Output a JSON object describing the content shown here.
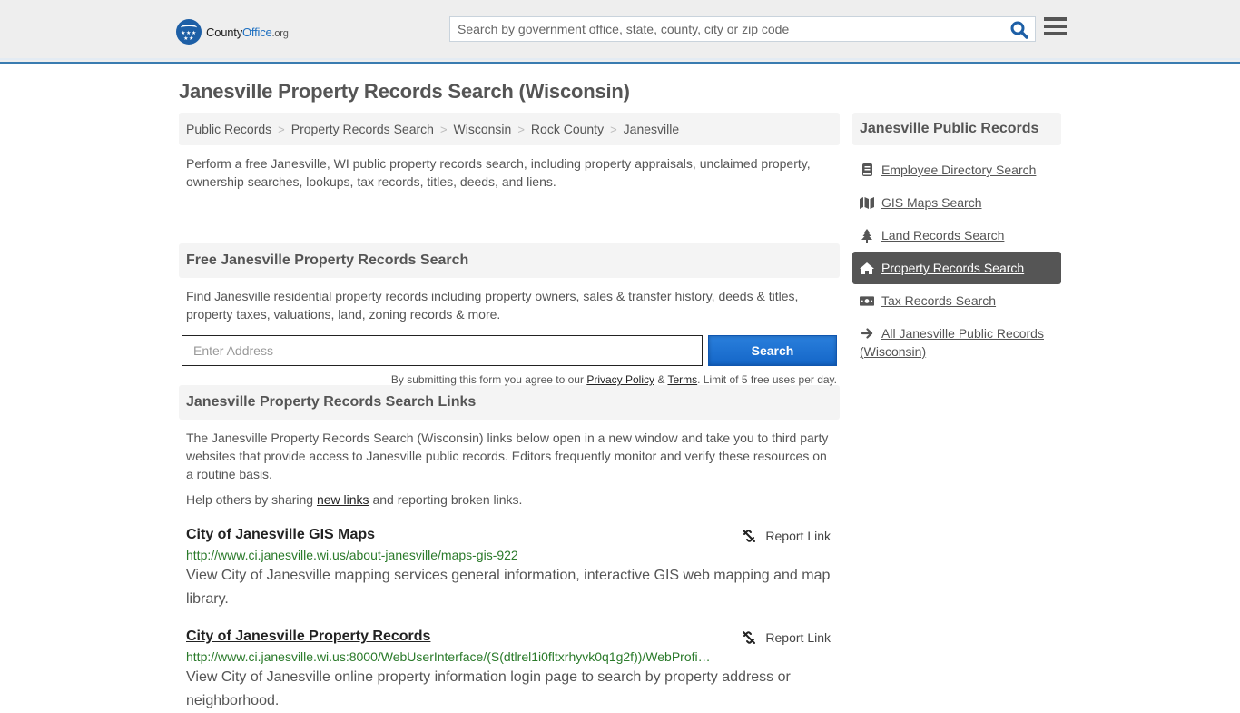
{
  "header": {
    "logo": {
      "name_part1": "County",
      "name_part2": "Office",
      "name_part3": ".org",
      "stars": "★★★ ★★"
    },
    "search_placeholder": "Search by government office, state, county, city or zip code",
    "colors": {
      "brand_blue": "#1d6fc0",
      "header_bg": "#eeeeee",
      "header_border": "#3a7cb0"
    }
  },
  "page": {
    "title": "Janesville Property Records Search (Wisconsin)",
    "breadcrumb": [
      "Public Records",
      "Property Records Search",
      "Wisconsin",
      "Rock County",
      "Janesville"
    ],
    "breadcrumb_separator": ">",
    "intro": "Perform a free Janesville, WI public property records search, including property appraisals, unclaimed property, ownership searches, lookups, tax records, titles, deeds, and liens."
  },
  "free_search": {
    "heading": "Free Janesville Property Records Search",
    "text": "Find Janesville residential property records including property owners, sales & transfer history, deeds & titles, property taxes, valuations, land, zoning records & more.",
    "input_placeholder": "Enter Address",
    "button_label": "Search",
    "terms_prefix": "By submitting this form you agree to our ",
    "privacy_label": "Privacy Policy",
    "amp": " & ",
    "terms_label": "Terms",
    "terms_suffix": ". Limit of 5 free uses per day."
  },
  "links_section": {
    "heading": "Janesville Property Records Search Links",
    "text": "The Janesville Property Records Search (Wisconsin) links below open in a new window and take you to third party websites that provide access to Janesville public records. Editors frequently monitor and verify these resources on a routine basis.",
    "help_prefix": "Help others by sharing ",
    "help_link": "new links",
    "help_suffix": " and reporting broken links.",
    "report_label": "Report Link",
    "items": [
      {
        "title": "City of Janesville GIS Maps",
        "url": "http://www.ci.janesville.wi.us/about-janesville/maps-gis-922",
        "description": "View City of Janesville mapping services general information, interactive GIS web mapping and map library."
      },
      {
        "title": "City of Janesville Property Records",
        "url": "http://www.ci.janesville.wi.us:8000/WebUserInterface/(S(dtlrel1i0fltxrhyvk0q1g2f))/WebProfi…",
        "description": "View City of Janesville online property information login page to search by property address or neighborhood."
      }
    ]
  },
  "sidebar": {
    "heading": "Janesville Public Records",
    "items": [
      {
        "label": "Employee Directory Search",
        "icon": "book-icon",
        "active": false
      },
      {
        "label": "GIS Maps Search",
        "icon": "map-icon",
        "active": false
      },
      {
        "label": "Land Records Search",
        "icon": "tree-icon",
        "active": false
      },
      {
        "label": "Property Records Search",
        "icon": "home-icon",
        "active": true
      },
      {
        "label": "Tax Records Search",
        "icon": "money-icon",
        "active": false
      },
      {
        "label": "All Janesville Public Records (Wisconsin)",
        "icon": "arrow-right-icon",
        "active": false
      }
    ]
  }
}
